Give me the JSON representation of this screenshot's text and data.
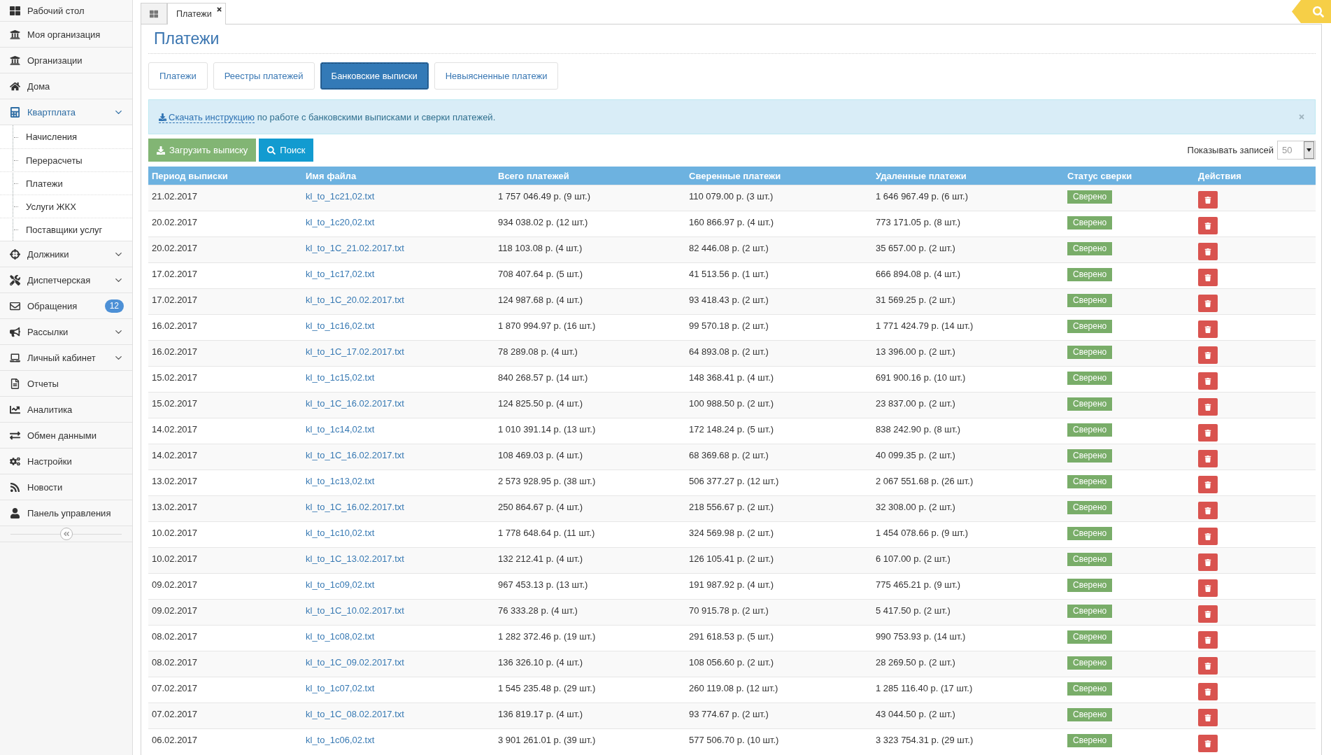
{
  "sidebar": {
    "items": [
      {
        "label": "Рабочий стол",
        "kind": "link",
        "selected": false
      },
      {
        "label": "Моя организация",
        "kind": "link",
        "selected": false
      },
      {
        "label": "Организации",
        "kind": "link",
        "selected": false
      },
      {
        "label": "Дома",
        "kind": "link",
        "selected": false
      },
      {
        "label": "Квартплата",
        "kind": "group",
        "selected": true,
        "children": [
          {
            "label": "Начисления",
            "selected": false
          },
          {
            "label": "Перерасчеты",
            "selected": false
          },
          {
            "label": "Платежи",
            "selected": false
          },
          {
            "label": "Услуги ЖКХ",
            "selected": false
          },
          {
            "label": "Поставщики услуг",
            "selected": false
          }
        ]
      },
      {
        "label": "Должники",
        "kind": "group",
        "selected": false
      },
      {
        "label": "Диспетчерская",
        "kind": "group",
        "selected": false
      },
      {
        "label": "Обращения",
        "kind": "link",
        "selected": false,
        "badge": "12"
      },
      {
        "label": "Рассылки",
        "kind": "group",
        "selected": false
      },
      {
        "label": "Личный кабинет",
        "kind": "group",
        "selected": false
      },
      {
        "label": "Отчеты",
        "kind": "link",
        "selected": false
      },
      {
        "label": "Аналитика",
        "kind": "link",
        "selected": false
      },
      {
        "label": "Обмен данными",
        "kind": "link",
        "selected": false
      },
      {
        "label": "Настройки",
        "kind": "link",
        "selected": false
      },
      {
        "label": "Новости",
        "kind": "link",
        "selected": false
      },
      {
        "label": "Панель управления",
        "kind": "link",
        "selected": false
      }
    ]
  },
  "tabs": [
    {
      "kind": "home",
      "selected": false
    },
    {
      "kind": "page",
      "label": "Платежи",
      "selected": true
    }
  ],
  "title": "Платежи",
  "section_tabs": [
    {
      "label": "Платежи",
      "selected": false
    },
    {
      "label": "Реестры платежей",
      "selected": false
    },
    {
      "label": "Банковские выписки",
      "selected": true
    },
    {
      "label": "Невыясненные платежи",
      "selected": false
    }
  ],
  "notice": {
    "link": "Скачать инструкцию",
    "text": "по работе с банковскими выписками и сверки платежей."
  },
  "toolbar": {
    "buttons": [
      {
        "kind": "upload",
        "label": "Загрузить выписку"
      },
      {
        "kind": "search",
        "label": "Поиск"
      }
    ],
    "page_size": {
      "label": "Показывать записей",
      "value": "50"
    }
  },
  "table": {
    "columns": [
      "Период выписки",
      "Имя файла",
      "Всего платежей",
      "Сверенные платежи",
      "Удаленные платежи",
      "Статус сверки",
      "Действия"
    ],
    "rows": [
      {
        "period": "21.02.2017",
        "file": "kl_to_1c21,02.txt",
        "total": "1 757 046.49 р. (9 шт.)",
        "reconciled": "110 079.00 р. (3 шт.)",
        "deleted": "1 646 967.49 р. (6 шт.)",
        "status": "Сверено"
      },
      {
        "period": "20.02.2017",
        "file": "kl_to_1c20,02.txt",
        "total": "934 038.02 р. (12 шт.)",
        "reconciled": "160 866.97 р. (4 шт.)",
        "deleted": "773 171.05 р. (8 шт.)",
        "status": "Сверено"
      },
      {
        "period": "20.02.2017",
        "file": "kl_to_1C_21.02.2017.txt",
        "total": "118 103.08 р. (4 шт.)",
        "reconciled": "82 446.08 р. (2 шт.)",
        "deleted": "35 657.00 р. (2 шт.)",
        "status": "Сверено"
      },
      {
        "period": "17.02.2017",
        "file": "kl_to_1c17,02.txt",
        "total": "708 407.64 р. (5 шт.)",
        "reconciled": "41 513.56 р. (1 шт.)",
        "deleted": "666 894.08 р. (4 шт.)",
        "status": "Сверено"
      },
      {
        "period": "17.02.2017",
        "file": "kl_to_1C_20.02.2017.txt",
        "total": "124 987.68 р. (4 шт.)",
        "reconciled": "93 418.43 р. (2 шт.)",
        "deleted": "31 569.25 р. (2 шт.)",
        "status": "Сверено"
      },
      {
        "period": "16.02.2017",
        "file": "kl_to_1c16,02.txt",
        "total": "1 870 994.97 р. (16 шт.)",
        "reconciled": "99 570.18 р. (2 шт.)",
        "deleted": "1 771 424.79 р. (14 шт.)",
        "status": "Сверено"
      },
      {
        "period": "16.02.2017",
        "file": "kl_to_1C_17.02.2017.txt",
        "total": "78 289.08 р. (4 шт.)",
        "reconciled": "64 893.08 р. (2 шт.)",
        "deleted": "13 396.00 р. (2 шт.)",
        "status": "Сверено"
      },
      {
        "period": "15.02.2017",
        "file": "kl_to_1c15,02.txt",
        "total": "840 268.57 р. (14 шт.)",
        "reconciled": "148 368.41 р. (4 шт.)",
        "deleted": "691 900.16 р. (10 шт.)",
        "status": "Сверено"
      },
      {
        "period": "15.02.2017",
        "file": "kl_to_1C_16.02.2017.txt",
        "total": "124 825.50 р. (4 шт.)",
        "reconciled": "100 988.50 р. (2 шт.)",
        "deleted": "23 837.00 р. (2 шт.)",
        "status": "Сверено"
      },
      {
        "period": "14.02.2017",
        "file": "kl_to_1c14,02.txt",
        "total": "1 010 391.14 р. (13 шт.)",
        "reconciled": "172 148.24 р. (5 шт.)",
        "deleted": "838 242.90 р. (8 шт.)",
        "status": "Сверено"
      },
      {
        "period": "14.02.2017",
        "file": "kl_to_1C_16.02.2017.txt",
        "total": "108 469.03 р. (4 шт.)",
        "reconciled": "68 369.68 р. (2 шт.)",
        "deleted": "40 099.35 р. (2 шт.)",
        "status": "Сверено"
      },
      {
        "period": "13.02.2017",
        "file": "kl_to_1c13,02.txt",
        "total": "2 573 928.95 р. (38 шт.)",
        "reconciled": "506 377.27 р. (12 шт.)",
        "deleted": "2 067 551.68 р. (26 шт.)",
        "status": "Сверено"
      },
      {
        "period": "13.02.2017",
        "file": "kl_to_1C_16.02.2017.txt",
        "total": "250 864.67 р. (4 шт.)",
        "reconciled": "218 556.67 р. (2 шт.)",
        "deleted": "32 308.00 р. (2 шт.)",
        "status": "Сверено"
      },
      {
        "period": "10.02.2017",
        "file": "kl_to_1c10,02.txt",
        "total": "1 778 648.64 р. (11 шт.)",
        "reconciled": "324 569.98 р. (2 шт.)",
        "deleted": "1 454 078.66 р. (9 шт.)",
        "status": "Сверено"
      },
      {
        "period": "10.02.2017",
        "file": "kl_to_1C_13.02.2017.txt",
        "total": "132 212.41 р. (4 шт.)",
        "reconciled": "126 105.41 р. (2 шт.)",
        "deleted": "6 107.00 р. (2 шт.)",
        "status": "Сверено"
      },
      {
        "period": "09.02.2017",
        "file": "kl_to_1c09,02.txt",
        "total": "967 453.13 р. (13 шт.)",
        "reconciled": "191 987.92 р. (4 шт.)",
        "deleted": "775 465.21 р. (9 шт.)",
        "status": "Сверено"
      },
      {
        "period": "09.02.2017",
        "file": "kl_to_1C_10.02.2017.txt",
        "total": "76 333.28 р. (4 шт.)",
        "reconciled": "70 915.78 р. (2 шт.)",
        "deleted": "5 417.50 р. (2 шт.)",
        "status": "Сверено"
      },
      {
        "period": "08.02.2017",
        "file": "kl_to_1c08,02.txt",
        "total": "1 282 372.46 р. (19 шт.)",
        "reconciled": "291 618.53 р. (5 шт.)",
        "deleted": "990 753.93 р. (14 шт.)",
        "status": "Сверено"
      },
      {
        "period": "08.02.2017",
        "file": "kl_to_1C_09.02.2017.txt",
        "total": "136 326.10 р. (4 шт.)",
        "reconciled": "108 056.60 р. (2 шт.)",
        "deleted": "28 269.50 р. (2 шт.)",
        "status": "Сверено"
      },
      {
        "period": "07.02.2017",
        "file": "kl_to_1c07,02.txt",
        "total": "1 545 235.48 р. (29 шт.)",
        "reconciled": "260 119.08 р. (12 шт.)",
        "deleted": "1 285 116.40 р. (17 шт.)",
        "status": "Сверено"
      },
      {
        "period": "07.02.2017",
        "file": "kl_to_1C_08.02.2017.txt",
        "total": "136 819.17 р. (4 шт.)",
        "reconciled": "93 774.67 р. (2 шт.)",
        "deleted": "43 044.50 р. (2 шт.)",
        "status": "Сверено"
      },
      {
        "period": "06.02.2017",
        "file": "kl_to_1c06,02.txt",
        "total": "3 901 261.01 р. (39 шт.)",
        "reconciled": "577 506.70 р. (10 шт.)",
        "deleted": "3 323 754.31 р. (29 шт.)",
        "status": "Сверено"
      }
    ]
  }
}
